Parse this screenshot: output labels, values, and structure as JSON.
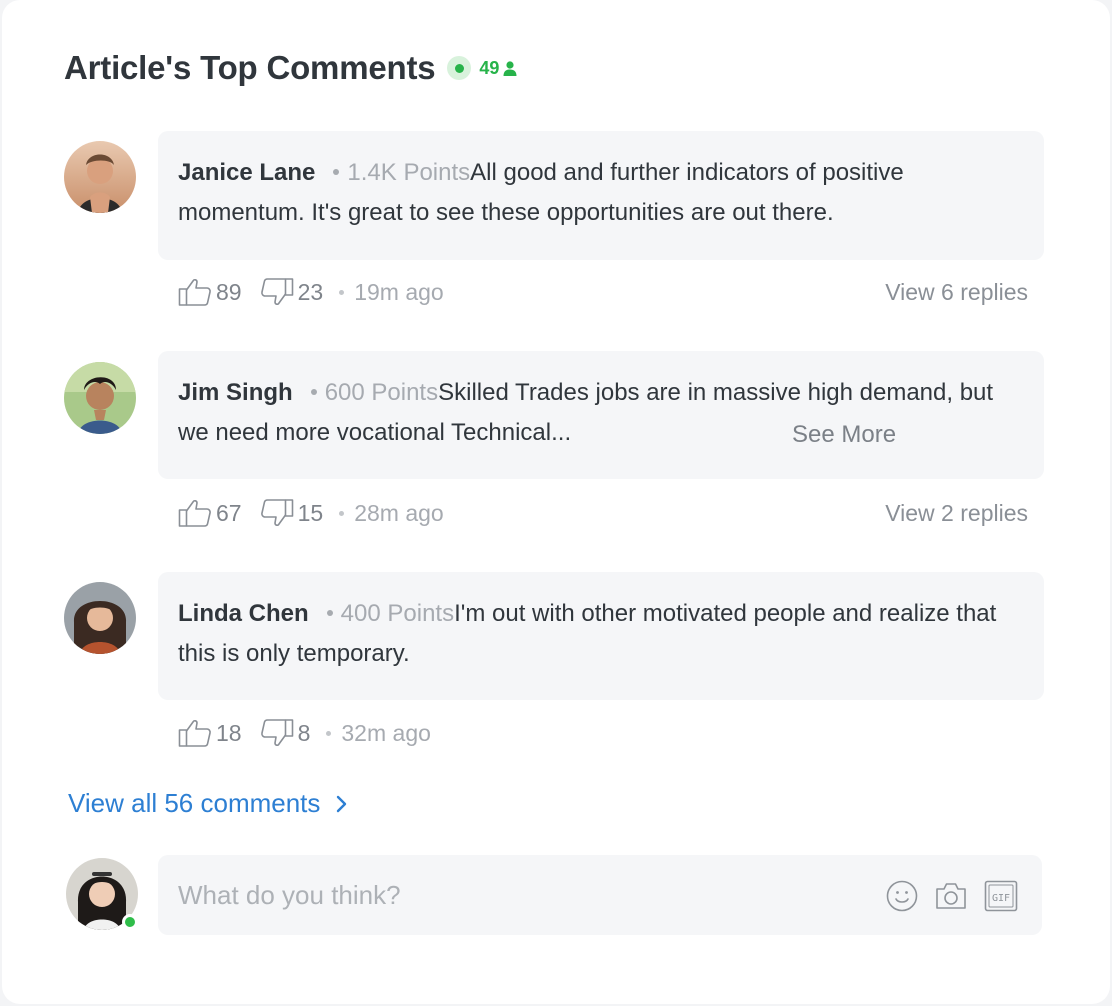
{
  "header": {
    "title": "Article's Top Comments",
    "live_count": "49",
    "colors": {
      "live": "#27b34a",
      "link": "#2d7fd3"
    }
  },
  "comments": [
    {
      "author": "Janice Lane",
      "points": "1.4K Points",
      "text": "All good and further indicators of positive momentum. It's great to see these opportunities are out there.",
      "see_more": "",
      "likes": "89",
      "dislikes": "23",
      "time": "19m ago",
      "replies": "View 6 replies"
    },
    {
      "author": "Jim Singh",
      "points": "600 Points",
      "text": "Skilled Trades jobs are in massive high demand, but we need more vocational Technical...",
      "see_more": "See More",
      "likes": "67",
      "dislikes": "15",
      "time": "28m ago",
      "replies": "View 2 replies"
    },
    {
      "author": "Linda Chen",
      "points": "400 Points",
      "text": "I'm out with other motivated people and realize that this is only temporary.",
      "see_more": "",
      "likes": "18",
      "dislikes": "8",
      "time": "32m ago",
      "replies": ""
    }
  ],
  "view_all": "View all 56 comments",
  "composer": {
    "placeholder": "What do you think?",
    "icons": [
      "emoji-icon",
      "camera-icon",
      "gif-icon"
    ]
  }
}
